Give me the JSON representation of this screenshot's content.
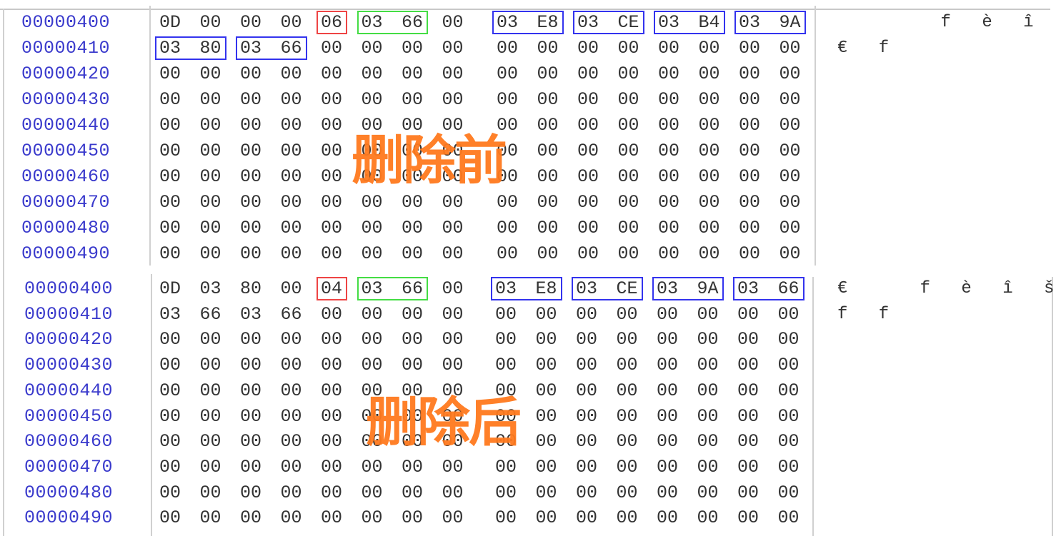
{
  "panels": [
    {
      "id": "before",
      "label": "删除前",
      "rows": [
        {
          "offset": "00000400",
          "bytes": [
            "0D",
            "00",
            "00",
            "00",
            "06",
            "03",
            "66",
            "00",
            "03",
            "E8",
            "03",
            "CE",
            "03",
            "B4",
            "03",
            "9A"
          ],
          "ascii": "     f è î ´ š"
        },
        {
          "offset": "00000410",
          "bytes": [
            "03",
            "80",
            "03",
            "66",
            "00",
            "00",
            "00",
            "00",
            "00",
            "00",
            "00",
            "00",
            "00",
            "00",
            "00",
            "00"
          ],
          "ascii": "€ f"
        },
        {
          "offset": "00000420",
          "bytes": [
            "00",
            "00",
            "00",
            "00",
            "00",
            "00",
            "00",
            "00",
            "00",
            "00",
            "00",
            "00",
            "00",
            "00",
            "00",
            "00"
          ],
          "ascii": ""
        },
        {
          "offset": "00000430",
          "bytes": [
            "00",
            "00",
            "00",
            "00",
            "00",
            "00",
            "00",
            "00",
            "00",
            "00",
            "00",
            "00",
            "00",
            "00",
            "00",
            "00"
          ],
          "ascii": ""
        },
        {
          "offset": "00000440",
          "bytes": [
            "00",
            "00",
            "00",
            "00",
            "00",
            "00",
            "00",
            "00",
            "00",
            "00",
            "00",
            "00",
            "00",
            "00",
            "00",
            "00"
          ],
          "ascii": ""
        },
        {
          "offset": "00000450",
          "bytes": [
            "00",
            "00",
            "00",
            "00",
            "00",
            "00",
            "00",
            "00",
            "00",
            "00",
            "00",
            "00",
            "00",
            "00",
            "00",
            "00"
          ],
          "ascii": ""
        },
        {
          "offset": "00000460",
          "bytes": [
            "00",
            "00",
            "00",
            "00",
            "00",
            "00",
            "00",
            "00",
            "00",
            "00",
            "00",
            "00",
            "00",
            "00",
            "00",
            "00"
          ],
          "ascii": ""
        },
        {
          "offset": "00000470",
          "bytes": [
            "00",
            "00",
            "00",
            "00",
            "00",
            "00",
            "00",
            "00",
            "00",
            "00",
            "00",
            "00",
            "00",
            "00",
            "00",
            "00"
          ],
          "ascii": ""
        },
        {
          "offset": "00000480",
          "bytes": [
            "00",
            "00",
            "00",
            "00",
            "00",
            "00",
            "00",
            "00",
            "00",
            "00",
            "00",
            "00",
            "00",
            "00",
            "00",
            "00"
          ],
          "ascii": ""
        },
        {
          "offset": "00000490",
          "bytes": [
            "00",
            "00",
            "00",
            "00",
            "00",
            "00",
            "00",
            "00",
            "00",
            "00",
            "00",
            "00",
            "00",
            "00",
            "00",
            "00"
          ],
          "ascii": ""
        }
      ],
      "highlights": [
        {
          "row": 0,
          "start": 4,
          "length": 1,
          "color": "red",
          "meaning": "cell-count"
        },
        {
          "row": 0,
          "start": 5,
          "length": 2,
          "color": "green",
          "meaning": "content-area-start"
        },
        {
          "row": 0,
          "start": 8,
          "length": 2,
          "color": "blue",
          "meaning": "cell-pointer"
        },
        {
          "row": 0,
          "start": 10,
          "length": 2,
          "color": "blue",
          "meaning": "cell-pointer"
        },
        {
          "row": 0,
          "start": 12,
          "length": 2,
          "color": "blue",
          "meaning": "cell-pointer"
        },
        {
          "row": 0,
          "start": 14,
          "length": 2,
          "color": "blue",
          "meaning": "cell-pointer"
        },
        {
          "row": 1,
          "start": 0,
          "length": 2,
          "color": "blue",
          "meaning": "cell-pointer"
        },
        {
          "row": 1,
          "start": 2,
          "length": 2,
          "color": "blue",
          "meaning": "cell-pointer"
        }
      ]
    },
    {
      "id": "after",
      "label": "删除后",
      "rows": [
        {
          "offset": "00000400",
          "bytes": [
            "0D",
            "03",
            "80",
            "00",
            "04",
            "03",
            "66",
            "00",
            "03",
            "E8",
            "03",
            "CE",
            "03",
            "9A",
            "03",
            "66"
          ],
          "ascii": "€   f è î š f"
        },
        {
          "offset": "00000410",
          "bytes": [
            "03",
            "66",
            "03",
            "66",
            "00",
            "00",
            "00",
            "00",
            "00",
            "00",
            "00",
            "00",
            "00",
            "00",
            "00",
            "00"
          ],
          "ascii": "f f"
        },
        {
          "offset": "00000420",
          "bytes": [
            "00",
            "00",
            "00",
            "00",
            "00",
            "00",
            "00",
            "00",
            "00",
            "00",
            "00",
            "00",
            "00",
            "00",
            "00",
            "00"
          ],
          "ascii": ""
        },
        {
          "offset": "00000430",
          "bytes": [
            "00",
            "00",
            "00",
            "00",
            "00",
            "00",
            "00",
            "00",
            "00",
            "00",
            "00",
            "00",
            "00",
            "00",
            "00",
            "00"
          ],
          "ascii": ""
        },
        {
          "offset": "00000440",
          "bytes": [
            "00",
            "00",
            "00",
            "00",
            "00",
            "00",
            "00",
            "00",
            "00",
            "00",
            "00",
            "00",
            "00",
            "00",
            "00",
            "00"
          ],
          "ascii": ""
        },
        {
          "offset": "00000450",
          "bytes": [
            "00",
            "00",
            "00",
            "00",
            "00",
            "00",
            "00",
            "00",
            "00",
            "00",
            "00",
            "00",
            "00",
            "00",
            "00",
            "00"
          ],
          "ascii": ""
        },
        {
          "offset": "00000460",
          "bytes": [
            "00",
            "00",
            "00",
            "00",
            "00",
            "00",
            "00",
            "00",
            "00",
            "00",
            "00",
            "00",
            "00",
            "00",
            "00",
            "00"
          ],
          "ascii": ""
        },
        {
          "offset": "00000470",
          "bytes": [
            "00",
            "00",
            "00",
            "00",
            "00",
            "00",
            "00",
            "00",
            "00",
            "00",
            "00",
            "00",
            "00",
            "00",
            "00",
            "00"
          ],
          "ascii": ""
        },
        {
          "offset": "00000480",
          "bytes": [
            "00",
            "00",
            "00",
            "00",
            "00",
            "00",
            "00",
            "00",
            "00",
            "00",
            "00",
            "00",
            "00",
            "00",
            "00",
            "00"
          ],
          "ascii": ""
        },
        {
          "offset": "00000490",
          "bytes": [
            "00",
            "00",
            "00",
            "00",
            "00",
            "00",
            "00",
            "00",
            "00",
            "00",
            "00",
            "00",
            "00",
            "00",
            "00",
            "00"
          ],
          "ascii": ""
        }
      ],
      "highlights": [
        {
          "row": 0,
          "start": 4,
          "length": 1,
          "color": "red",
          "meaning": "cell-count"
        },
        {
          "row": 0,
          "start": 5,
          "length": 2,
          "color": "green",
          "meaning": "content-area-start"
        },
        {
          "row": 0,
          "start": 8,
          "length": 2,
          "color": "blue",
          "meaning": "cell-pointer"
        },
        {
          "row": 0,
          "start": 10,
          "length": 2,
          "color": "blue",
          "meaning": "cell-pointer"
        },
        {
          "row": 0,
          "start": 12,
          "length": 2,
          "color": "blue",
          "meaning": "cell-pointer"
        },
        {
          "row": 0,
          "start": 14,
          "length": 2,
          "color": "blue",
          "meaning": "cell-pointer"
        }
      ]
    }
  ],
  "colors": {
    "offset_text": "#3a3acc",
    "byte_text": "#333333",
    "overlay_label": "#ff7a1e",
    "highlight_red": "#ee4444",
    "highlight_green": "#44dd44",
    "highlight_blue": "#3333ee"
  }
}
